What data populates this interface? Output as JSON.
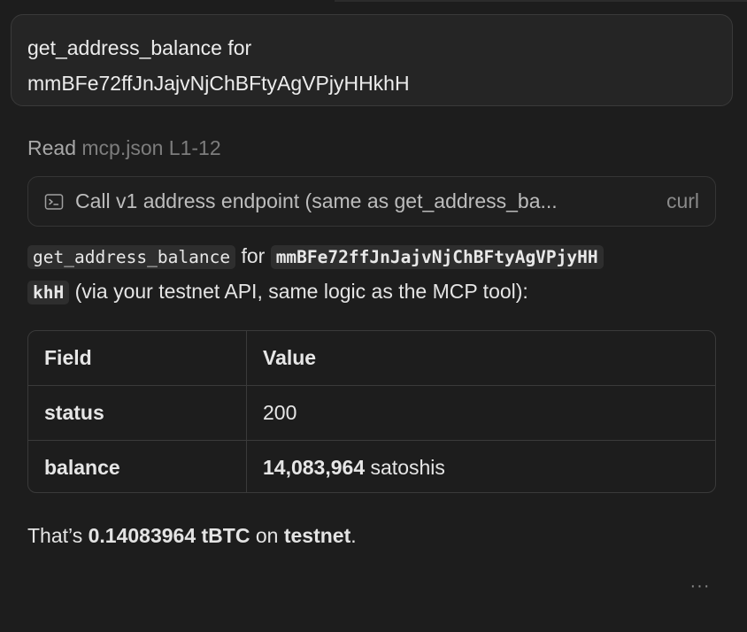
{
  "query": {
    "line1": "get_address_balance for",
    "line2": "mmBFe72ffJnJajvNjChBFtyAgVPjyHHkhH"
  },
  "read_step": {
    "verb": "Read",
    "file": "mcp.json L1-12"
  },
  "tool_call": {
    "icon": "terminal-icon",
    "description": "Call v1 address endpoint (same as get_address_ba...",
    "command": "curl"
  },
  "answer": {
    "fn_name": "get_address_balance",
    "for_word": "for",
    "address_part1": "mmBFe72ffJnJajvNjChBFtyAgVPjyHH",
    "address_part2": "khH",
    "rest": "(via your testnet API, same logic as the MCP tool):"
  },
  "table": {
    "headers": [
      "Field",
      "Value"
    ],
    "rows": [
      {
        "field": "status",
        "value": "200",
        "value_unit": ""
      },
      {
        "field": "balance",
        "value": "14,083,964",
        "value_unit": "satoshis"
      }
    ]
  },
  "summary": {
    "prefix": "That’s",
    "amount": "0.14083964 tBTC",
    "mid": "on",
    "network": "testnet",
    "suffix": "."
  },
  "more_menu": {
    "label": "···",
    "icon": "more-horizontal-icon"
  }
}
